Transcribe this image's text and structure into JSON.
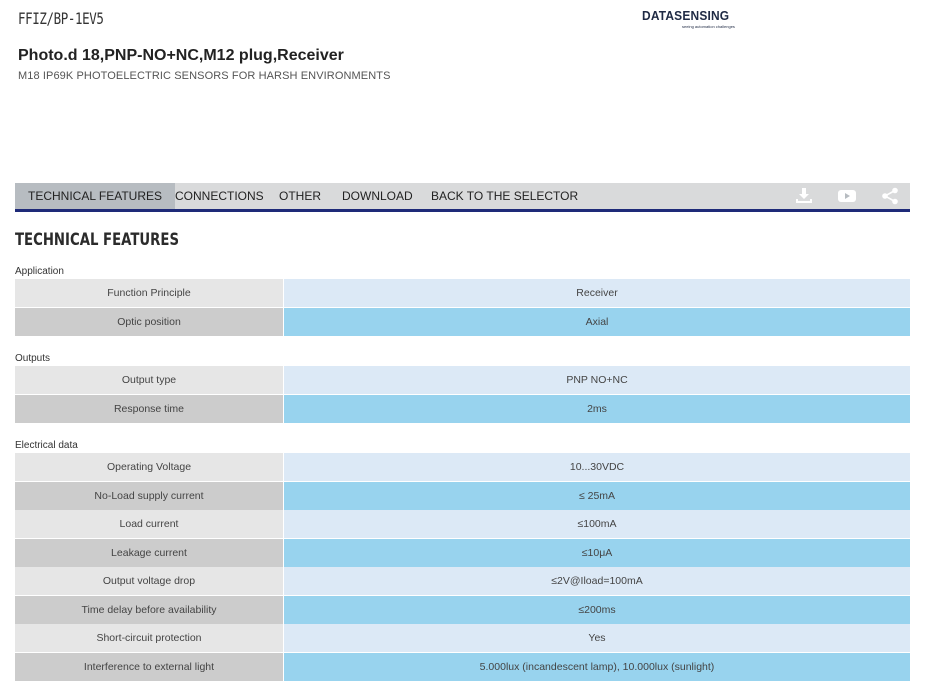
{
  "header": {
    "product_code": "FFIZ/BP-1EV5",
    "brand_logo_text": "DATASENSING",
    "brand_tagline": "seeing automation challenges",
    "product_title": "Photo.d 18,PNP-NO+NC,M12 plug,Receiver",
    "product_subtitle": "M18 IP69K PHOTOELECTRIC SENSORS FOR HARSH ENVIRONMENTS"
  },
  "tabs": [
    {
      "label": "TECHNICAL FEATURES",
      "active": true
    },
    {
      "label": "CONNECTIONS",
      "active": false
    },
    {
      "label": "OTHER",
      "active": false
    },
    {
      "label": "DOWNLOAD",
      "active": false
    },
    {
      "label": "BACK TO THE SELECTOR",
      "active": false
    }
  ],
  "tab_icons": [
    "download-icon",
    "youtube-icon",
    "share-icon"
  ],
  "section_title": "TECHNICAL FEATURES",
  "groups": [
    {
      "label": "Application",
      "rows": [
        {
          "label": "Function Principle",
          "value": "Receiver"
        },
        {
          "label": "Optic position",
          "value": "Axial"
        }
      ]
    },
    {
      "label": "Outputs",
      "rows": [
        {
          "label": "Output type",
          "value": "PNP NO+NC"
        },
        {
          "label": "Response time",
          "value": "2ms"
        }
      ]
    },
    {
      "label": "Electrical data",
      "rows": [
        {
          "label": "Operating Voltage",
          "value": "10...30VDC"
        },
        {
          "label": "No-Load supply current",
          "value": "≤ 25mA"
        },
        {
          "label": "Load current",
          "value": "≤100mA"
        },
        {
          "label": "Leakage current",
          "value": "≤10μA"
        },
        {
          "label": "Output voltage drop",
          "value": "≤2V@Iload=100mA"
        },
        {
          "label": "Time delay before availability",
          "value": "≤200ms"
        },
        {
          "label": "Short-circuit protection",
          "value": "Yes"
        },
        {
          "label": "Interference to external light",
          "value": "5.000lux (incandescent lamp), 10.000lux (sunlight)"
        }
      ]
    }
  ],
  "colors": {
    "tabbar_bg": "#d9dadb",
    "tab_active_bg": "#b7bcc1",
    "tabbar_underline": "#1e2a78",
    "row_label_light": "#e6e6e6",
    "row_label_dark": "#cccccc",
    "row_value_light": "#dce9f6",
    "row_value_dark": "#98d3ee"
  }
}
